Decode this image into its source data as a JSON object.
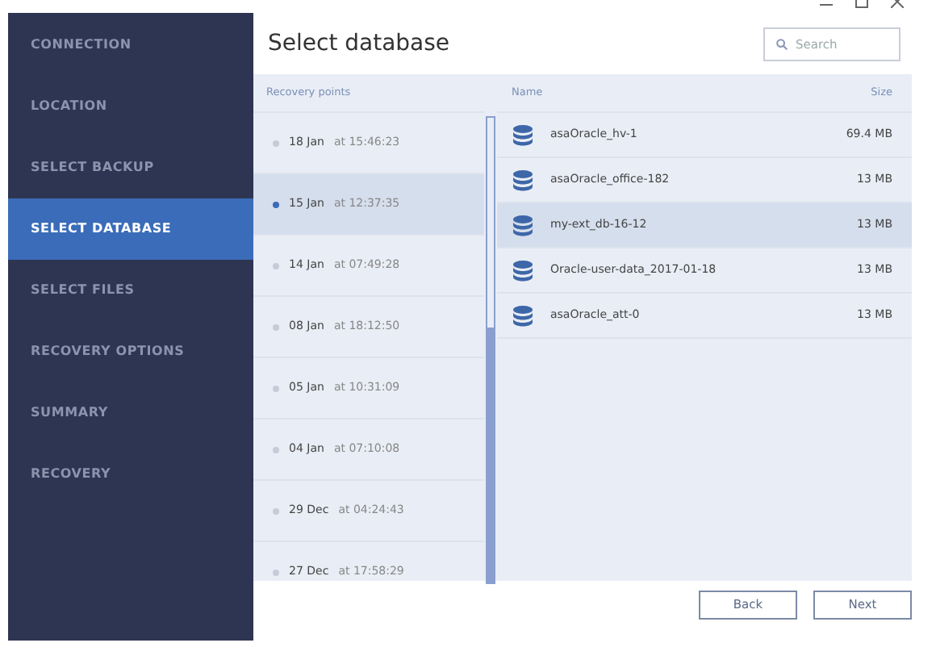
{
  "sidebar": {
    "items": [
      {
        "label": "CONNECTION",
        "selected": false
      },
      {
        "label": "LOCATION",
        "selected": false
      },
      {
        "label": "SELECT BACKUP",
        "selected": false
      },
      {
        "label": "SELECT DATABASE",
        "selected": true
      },
      {
        "label": "SELECT FILES",
        "selected": false
      },
      {
        "label": "RECOVERY OPTIONS",
        "selected": false
      },
      {
        "label": "SUMMARY",
        "selected": false
      },
      {
        "label": "RECOVERY",
        "selected": false
      }
    ]
  },
  "header": {
    "title": "Select database",
    "search": {
      "placeholder": "Search"
    }
  },
  "recovery_points": {
    "heading": "Recovery points",
    "rows": [
      {
        "date": "18 Jan",
        "time": "at 15:46:23",
        "selected": false
      },
      {
        "date": "15 Jan",
        "time": "at 12:37:35",
        "selected": true
      },
      {
        "date": "14 Jan",
        "time": "at 07:49:28",
        "selected": false
      },
      {
        "date": "08 Jan",
        "time": "at 18:12:50",
        "selected": false
      },
      {
        "date": "05 Jan",
        "time": "at 10:31:09",
        "selected": false
      },
      {
        "date": "04 Jan",
        "time": "at 07:10:08",
        "selected": false
      },
      {
        "date": "29 Dec",
        "time": "at 04:24:43",
        "selected": false
      },
      {
        "date": "27 Dec",
        "time": "at 17:58:29",
        "selected": false
      }
    ]
  },
  "databases": {
    "columns": [
      "Name",
      "Size"
    ],
    "rows": [
      {
        "name": "asaOracle_hv-1",
        "size": "69.4 MB",
        "selected": false
      },
      {
        "name": "asaOracle_office-182",
        "size": "13 MB",
        "selected": false
      },
      {
        "name": "my-ext_db-16-12",
        "size": "13 MB",
        "selected": true
      },
      {
        "name": "Oracle-user-data_2017-01-18",
        "size": "13 MB",
        "selected": false
      },
      {
        "name": "asaOracle_att-0",
        "size": "13 MB",
        "selected": false
      }
    ]
  },
  "buttons": [
    {
      "label": "Back"
    },
    {
      "label": "Next"
    }
  ]
}
